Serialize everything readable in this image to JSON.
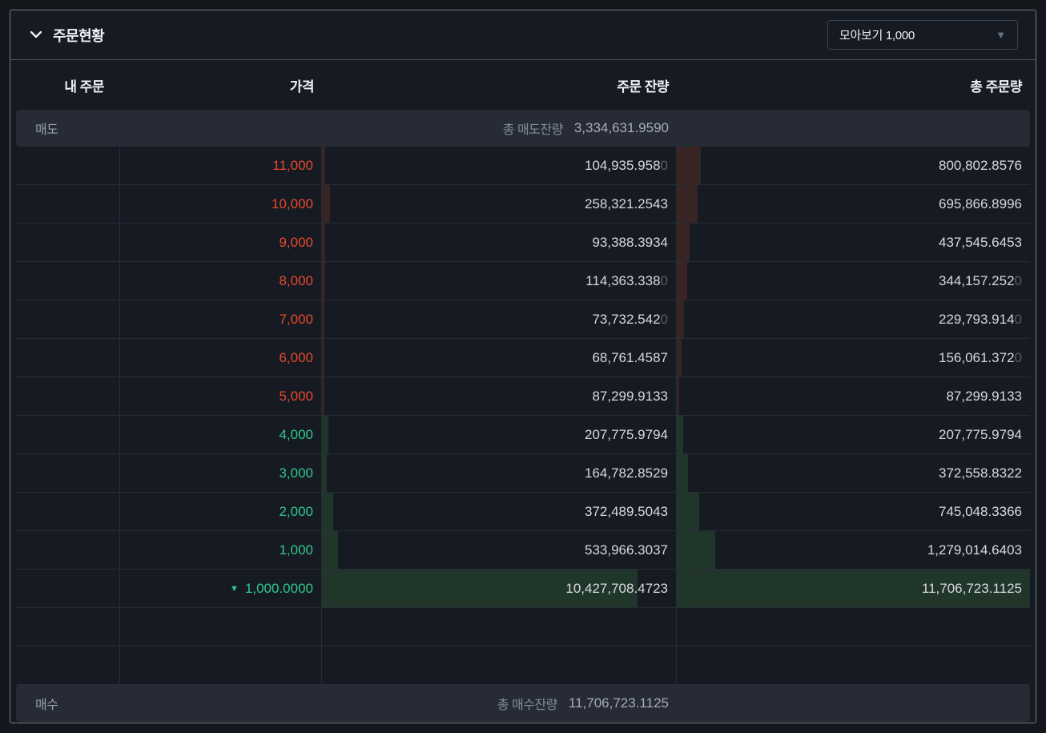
{
  "panel": {
    "title": "주문현황",
    "group_select": {
      "label": "모아보기 1,000",
      "caret_icon": "caret-down"
    }
  },
  "table": {
    "headers": [
      "내 주문",
      "가격",
      "주문 잔량",
      "총 주문량"
    ],
    "sell_summary": {
      "side_label": "매도",
      "total_label": "총 매도잔량",
      "total_value": "3,334,631.9590"
    },
    "buy_summary": {
      "side_label": "매수",
      "total_label": "총 매수잔량",
      "total_value": "11,706,723.1125"
    },
    "max_total": 11706723.1125,
    "empty_rows": 2,
    "rows": [
      {
        "side": "sell",
        "arrow": "",
        "price": "11,000",
        "remaining": {
          "main": "104,935.958",
          "dim": "0",
          "value": 104935.958
        },
        "total": {
          "main": "800,802.8576",
          "dim": "",
          "value": 800802.8576
        }
      },
      {
        "side": "sell",
        "arrow": "",
        "price": "10,000",
        "remaining": {
          "main": "258,321.2543",
          "dim": "",
          "value": 258321.2543
        },
        "total": {
          "main": "695,866.8996",
          "dim": "",
          "value": 695866.8996
        }
      },
      {
        "side": "sell",
        "arrow": "",
        "price": "9,000",
        "remaining": {
          "main": "93,388.3934",
          "dim": "",
          "value": 93388.3934
        },
        "total": {
          "main": "437,545.6453",
          "dim": "",
          "value": 437545.6453
        }
      },
      {
        "side": "sell",
        "arrow": "",
        "price": "8,000",
        "remaining": {
          "main": "114,363.338",
          "dim": "0",
          "value": 114363.338
        },
        "total": {
          "main": "344,157.252",
          "dim": "0",
          "value": 344157.252
        }
      },
      {
        "side": "sell",
        "arrow": "",
        "price": "7,000",
        "remaining": {
          "main": "73,732.542",
          "dim": "0",
          "value": 73732.542
        },
        "total": {
          "main": "229,793.914",
          "dim": "0",
          "value": 229793.914
        }
      },
      {
        "side": "sell",
        "arrow": "",
        "price": "6,000",
        "remaining": {
          "main": "68,761.4587",
          "dim": "",
          "value": 68761.4587
        },
        "total": {
          "main": "156,061.372",
          "dim": "0",
          "value": 156061.372
        }
      },
      {
        "side": "sell",
        "arrow": "",
        "price": "5,000",
        "remaining": {
          "main": "87,299.9133",
          "dim": "",
          "value": 87299.9133
        },
        "total": {
          "main": "87,299.9133",
          "dim": "",
          "value": 87299.9133
        }
      },
      {
        "side": "buy",
        "arrow": "",
        "price": "4,000",
        "remaining": {
          "main": "207,775.9794",
          "dim": "",
          "value": 207775.9794
        },
        "total": {
          "main": "207,775.9794",
          "dim": "",
          "value": 207775.9794
        }
      },
      {
        "side": "buy",
        "arrow": "",
        "price": "3,000",
        "remaining": {
          "main": "164,782.8529",
          "dim": "",
          "value": 164782.8529
        },
        "total": {
          "main": "372,558.8322",
          "dim": "",
          "value": 372558.8322
        }
      },
      {
        "side": "buy",
        "arrow": "",
        "price": "2,000",
        "remaining": {
          "main": "372,489.5043",
          "dim": "",
          "value": 372489.5043
        },
        "total": {
          "main": "745,048.3366",
          "dim": "",
          "value": 745048.3366
        }
      },
      {
        "side": "buy",
        "arrow": "",
        "price": "1,000",
        "remaining": {
          "main": "533,966.3037",
          "dim": "",
          "value": 533966.3037
        },
        "total": {
          "main": "1,279,014.6403",
          "dim": "",
          "value": 1279014.6403
        }
      },
      {
        "side": "buy",
        "arrow": "▼",
        "price": "1,000.0000",
        "remaining": {
          "main": "10,427,708.4723",
          "dim": "",
          "value": 10427708.4723
        },
        "total": {
          "main": "11,706,723.1125",
          "dim": "",
          "value": 11706723.1125
        }
      }
    ]
  },
  "colors": {
    "sell_price": "#e84a2a",
    "buy_price": "#2fc98c",
    "sell_bar": "#382423",
    "buy_bar": "#21362b",
    "panel_bg": "#161a23",
    "summary_bg": "#262b35"
  }
}
